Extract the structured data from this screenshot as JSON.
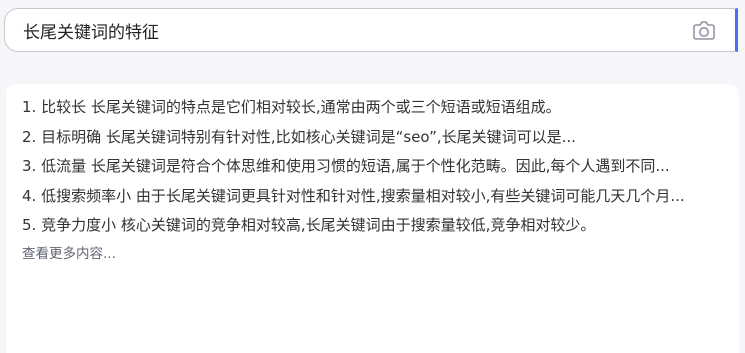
{
  "search": {
    "query": "长尾关键词的特征"
  },
  "icons": {
    "camera": "camera-icon"
  },
  "colors": {
    "accent": "#4e6ef2",
    "text": "#333333",
    "muted": "#626675",
    "background": "#f5f6f9"
  },
  "answer": {
    "items": [
      {
        "text": "1. 比较长 长尾关键词的特点是它们相对较长,通常由两个或三个短语或短语组成。"
      },
      {
        "text": "2. 目标明确 长尾关键词特别有针对性,比如核心关键词是“seo”,长尾关键词可以是..."
      },
      {
        "text": "3. 低流量 长尾关键词是符合个体思维和使用习惯的短语,属于个性化范畴。因此,每个人遇到不同..."
      },
      {
        "text": "4. 低搜索频率小 由于长尾关键词更具针对性和针对性,搜索量相对较小,有些关键词可能几天几个月..."
      },
      {
        "text": "5. 竞争力度小 核心关键词的竞争相对较高,长尾关键词由于搜索量较低,竞争相对较少。"
      }
    ],
    "more_label": "查看更多内容..."
  }
}
